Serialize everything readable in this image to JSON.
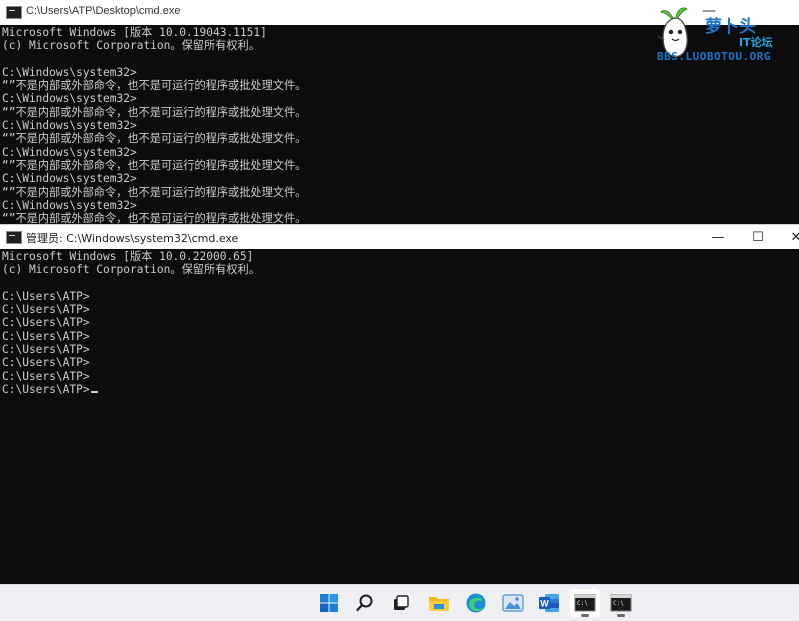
{
  "window_back": {
    "title": "C:\\Users\\ATP\\Desktop\\cmd.exe",
    "minimize_glyph": "—",
    "lines": [
      "Microsoft Windows [版本 10.0.19043.1151]",
      "(c) Microsoft Corporation。保留所有权利。",
      "",
      "C:\\Windows\\system32>",
      "“”不是内部或外部命令，也不是可运行的程序或批处理文件。",
      "C:\\Windows\\system32>",
      "“”不是内部或外部命令，也不是可运行的程序或批处理文件。",
      "C:\\Windows\\system32>",
      "“”不是内部或外部命令，也不是可运行的程序或批处理文件。",
      "C:\\Windows\\system32>",
      "“”不是内部或外部命令，也不是可运行的程序或批处理文件。",
      "C:\\Windows\\system32>",
      "“”不是内部或外部命令，也不是可运行的程序或批处理文件。",
      "C:\\Windows\\system32>",
      "“”不是内部或外部命令，也不是可运行的程序或批处理文件。",
      "C:\\Windows\\system32>"
    ]
  },
  "watermark": {
    "title": "萝卜头",
    "subtitle": "IT论坛",
    "url": "BBS.LUOBOTOU.ORG"
  },
  "window_front": {
    "title": "管理员: C:\\Windows\\system32\\cmd.exe",
    "controls": {
      "minimize": "—",
      "maximize": "☐",
      "close": "✕"
    },
    "lines": [
      "Microsoft Windows [版本 10.0.22000.65]",
      "(c) Microsoft Corporation。保留所有权利。",
      "",
      "C:\\Users\\ATP>",
      "C:\\Users\\ATP>",
      "C:\\Users\\ATP>",
      "C:\\Users\\ATP>",
      "C:\\Users\\ATP>",
      "C:\\Users\\ATP>",
      "C:\\Users\\ATP>",
      "C:\\Users\\ATP>"
    ]
  },
  "taskbar": {
    "icons": [
      {
        "name": "start-icon",
        "active": false
      },
      {
        "name": "search-icon",
        "active": false
      },
      {
        "name": "task-view-icon",
        "active": false
      },
      {
        "name": "file-explorer-icon",
        "active": false
      },
      {
        "name": "edge-browser-icon",
        "active": false
      },
      {
        "name": "image-viewer-icon",
        "active": false
      },
      {
        "name": "word-icon",
        "active": false
      },
      {
        "name": "cmd-icon",
        "active": true
      },
      {
        "name": "cmd-icon",
        "active": false
      }
    ]
  },
  "colors": {
    "console_bg": "#0c0c0c",
    "console_text": "#cccccc",
    "titlebar_bg": "#ffffff",
    "taskbar_bg": "#eef0f4",
    "accent_blue": "#1f73c9"
  }
}
